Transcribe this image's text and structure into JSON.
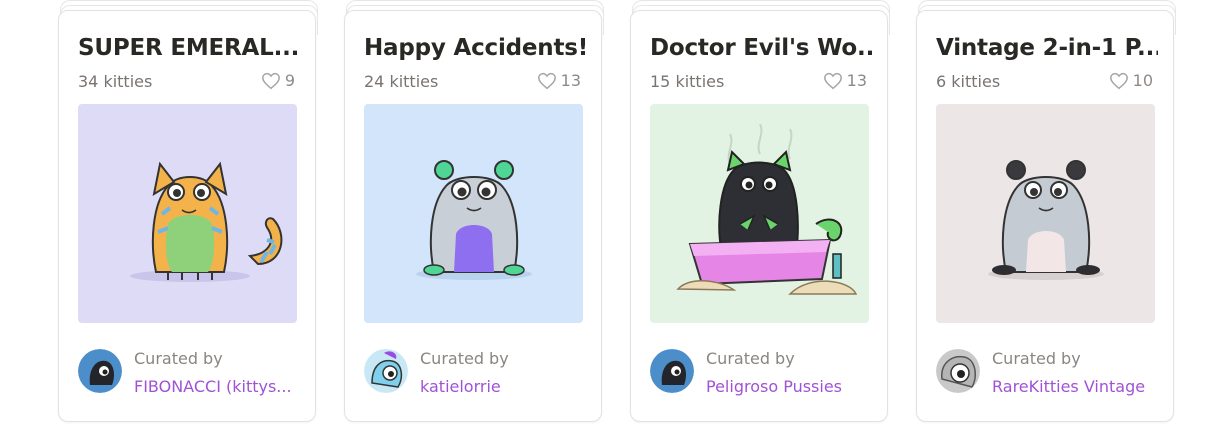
{
  "cards": [
    {
      "title": "SUPER EMERAL...",
      "count": "34 kitties",
      "likes": "9",
      "curated_label": "Curated by",
      "curator": "FIBONACCI (kittys...",
      "bg": "#dedbf7",
      "avatar_bg": "#4b8ec9"
    },
    {
      "title": "Happy Accidents!",
      "count": "24 kitties",
      "likes": "13",
      "curated_label": "Curated by",
      "curator": "katielorrie",
      "bg": "#d2e5fb",
      "avatar_bg": "#c8e8f5"
    },
    {
      "title": "Doctor Evil's Wo...",
      "count": "15 kitties",
      "likes": "13",
      "curated_label": "Curated by",
      "curator": "Peligroso Pussies",
      "bg": "#e3f3e3",
      "avatar_bg": "#4b8ec9"
    },
    {
      "title": "Vintage 2-in-1 P...",
      "count": "6 kitties",
      "likes": "10",
      "curated_label": "Curated by",
      "curator": "RareKitties Vintage",
      "bg": "#ede6e6",
      "avatar_bg": "#c9c9c9"
    }
  ],
  "icons": {
    "like": "heart-outline-icon"
  },
  "colors": {
    "curator_link": "#a052d6",
    "muted_text": "#7a7470"
  }
}
